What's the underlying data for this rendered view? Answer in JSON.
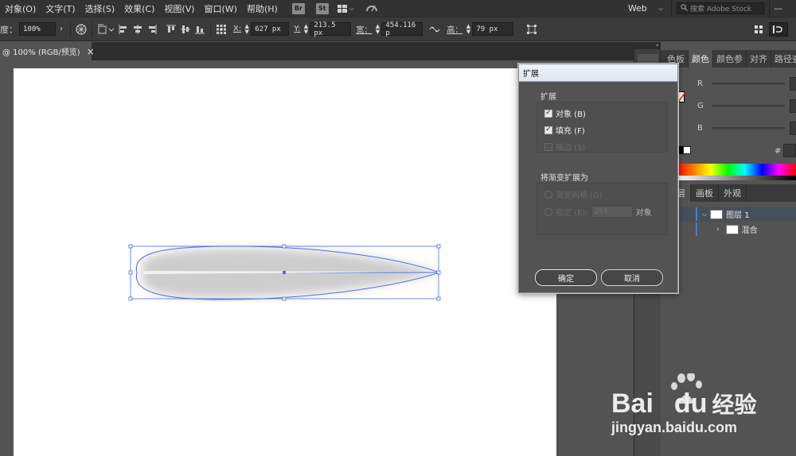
{
  "menubar": {
    "items": [
      "对象(O)",
      "文字(T)",
      "选择(S)",
      "效果(C)",
      "视图(V)",
      "窗口(W)",
      "帮助(H)"
    ],
    "bridge_label": "Br",
    "stock_label": "St",
    "workspace": "Web",
    "search_placeholder": "搜索 Adobe Stock"
  },
  "controlbar": {
    "opacity_label": "度：",
    "opacity_value": "100%",
    "x_label": "X:",
    "x_value": "627 px",
    "y_label": "Y:",
    "y_value": "213.5 px",
    "w_label": "宽：",
    "w_value": "454.116 p",
    "h_label": "高：",
    "h_value": "79 px"
  },
  "document_tab": {
    "title": "@ 100% (RGB/预览)",
    "close": "×"
  },
  "color_panel": {
    "tabs": [
      "色板",
      "颜色",
      "颜色参",
      "对齐",
      "路径查"
    ],
    "active_tab": "颜色",
    "channels": [
      "R",
      "G",
      "B"
    ],
    "hex_label": "#"
  },
  "layers_panel": {
    "tabs": [
      "层",
      "画板",
      "外观"
    ],
    "rows": [
      {
        "name": "图层 1",
        "expanded": true
      },
      {
        "name": "混合",
        "expanded": false
      }
    ]
  },
  "dialog": {
    "title": "扩展",
    "expand_group": "扩展",
    "options": [
      {
        "label": "对象 (B)",
        "checked": true,
        "enabled": true
      },
      {
        "label": "填充 (F)",
        "checked": true,
        "enabled": true
      },
      {
        "label": "描边 (S)",
        "checked": false,
        "enabled": false
      }
    ],
    "gradient_group": "将渐变扩展为",
    "radios": [
      {
        "label": "渐变网格 (G)",
        "enabled": false
      },
      {
        "label": "指定 (E):",
        "enabled": false
      }
    ],
    "specify_value": "255",
    "specify_unit": "对象",
    "ok_label": "确定",
    "cancel_label": "取消"
  },
  "watermark": {
    "brand": "Bai",
    "brand2": "du",
    "cn": "经验",
    "url": "jingyan.baidu.com"
  },
  "colors": {
    "accent": "#4a7fc8",
    "selection": "#4f6ce0",
    "ui_dark": "#323232",
    "ui_mid": "#535353"
  }
}
